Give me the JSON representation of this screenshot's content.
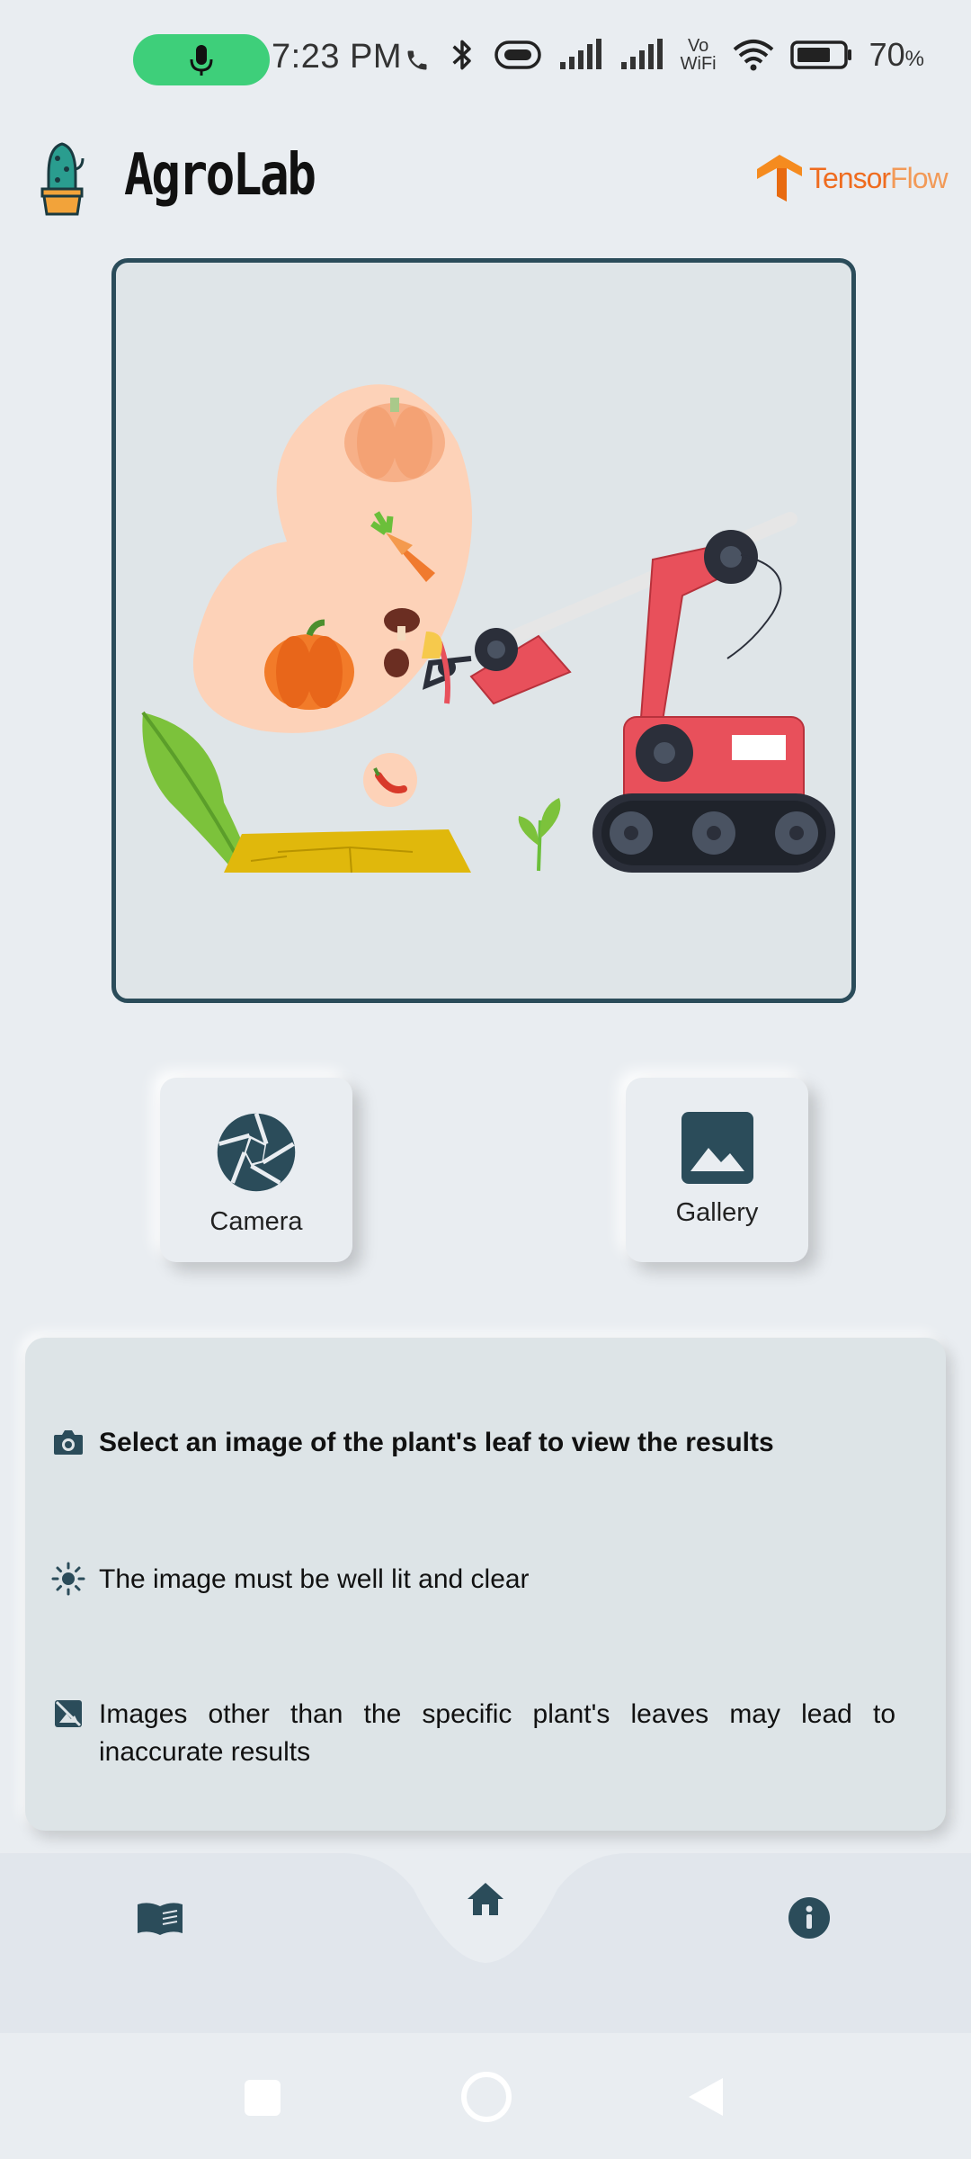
{
  "status_bar": {
    "time": "7:23 PM",
    "battery": "70",
    "battery_unit": "%",
    "vowifi_top": "Vo",
    "vowifi_bottom": "WiFi",
    "icons": [
      "mic-icon",
      "call-icon",
      "bluetooth-icon",
      "data-saver-icon",
      "signal-icon",
      "signal-icon",
      "vowifi-icon",
      "wifi-icon",
      "battery-icon"
    ]
  },
  "header": {
    "app_title": "AgroLab",
    "brand_logo_text_a": "Tensor",
    "brand_logo_text_b": "Flow"
  },
  "actions": {
    "camera_label": "Camera",
    "gallery_label": "Gallery"
  },
  "info": {
    "items": [
      {
        "icon": "camera-icon",
        "text": "Select an image of the plant's leaf to view the results"
      },
      {
        "icon": "brightness-icon",
        "text": "The image must be well lit and clear"
      },
      {
        "icon": "no-image-icon",
        "text": "Images other than the specific plant's leaves may lead to inaccurate results"
      }
    ]
  },
  "bottom_nav": {
    "items": [
      "book-icon",
      "home-icon",
      "info-icon"
    ],
    "active": "home-icon"
  },
  "colors": {
    "accent": "#2b4c5a",
    "background": "#e9edf1",
    "card": "#dde4e7",
    "mic_pill": "#3ecf7a",
    "robot_red": "#e8505b"
  }
}
